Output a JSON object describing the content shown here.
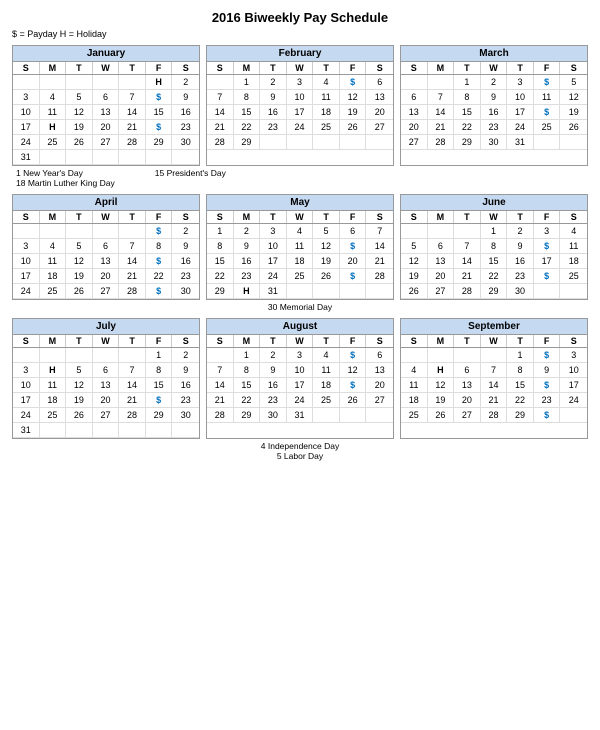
{
  "title": "2016 Biweekly Pay Schedule",
  "legend": "$ = Payday    H = Holiday",
  "months": [
    {
      "name": "January",
      "days": [
        "",
        "",
        "",
        "",
        "",
        "H",
        "2",
        "3",
        "4",
        "5",
        "6",
        "7",
        "$",
        "9",
        "10",
        "11",
        "12",
        "13",
        "14",
        "15",
        "16",
        "17",
        "H",
        "19",
        "20",
        "21",
        "$",
        "23",
        "24",
        "25",
        "26",
        "27",
        "28",
        "29",
        "30",
        "31",
        "",
        "",
        "",
        "",
        "",
        ""
      ],
      "notes": [
        "1 New Year's Day",
        "18 Martin Luther King Day"
      ]
    },
    {
      "name": "February",
      "days": [
        "",
        "1",
        "2",
        "3",
        "4",
        "$",
        "6",
        "7",
        "8",
        "9",
        "10",
        "11",
        "12",
        "13",
        "14",
        "15",
        "16",
        "17",
        "18",
        "19",
        "20",
        "21",
        "22",
        "23",
        "24",
        "25",
        "26",
        "27",
        "28",
        "29",
        "",
        "",
        "",
        "",
        ""
      ],
      "notes": [
        "15 President's Day"
      ]
    },
    {
      "name": "March",
      "days": [
        "",
        "",
        "1",
        "2",
        "3",
        "$",
        "5",
        "6",
        "7",
        "8",
        "9",
        "10",
        "11",
        "12",
        "13",
        "14",
        "15",
        "16",
        "17",
        "$",
        "19",
        "20",
        "21",
        "22",
        "23",
        "24",
        "25",
        "26",
        "27",
        "28",
        "29",
        "30",
        "31",
        "",
        ""
      ],
      "notes": []
    },
    {
      "name": "April",
      "days": [
        "",
        "",
        "",
        "",
        "",
        "$",
        "2",
        "3",
        "4",
        "5",
        "6",
        "7",
        "8",
        "9",
        "10",
        "11",
        "12",
        "13",
        "14",
        "$",
        "16",
        "17",
        "18",
        "19",
        "20",
        "21",
        "22",
        "23",
        "24",
        "25",
        "26",
        "27",
        "28",
        "$",
        "30"
      ],
      "notes": []
    },
    {
      "name": "May",
      "days": [
        "1",
        "2",
        "3",
        "4",
        "5",
        "6",
        "7",
        "8",
        "9",
        "10",
        "11",
        "12",
        "$",
        "14",
        "15",
        "16",
        "17",
        "18",
        "19",
        "20",
        "21",
        "22",
        "23",
        "24",
        "25",
        "26",
        "$",
        "28",
        "29",
        "H",
        "31",
        "",
        "",
        "",
        ""
      ],
      "notes": [
        "30 Memorial Day"
      ]
    },
    {
      "name": "June",
      "days": [
        "",
        "",
        "",
        "1",
        "2",
        "3",
        "4",
        "5",
        "6",
        "7",
        "8",
        "9",
        "$",
        "11",
        "12",
        "13",
        "14",
        "15",
        "16",
        "17",
        "18",
        "19",
        "20",
        "21",
        "22",
        "23",
        "$",
        "25",
        "26",
        "27",
        "28",
        "29",
        "30",
        "",
        ""
      ],
      "notes": []
    },
    {
      "name": "July",
      "days": [
        "",
        "",
        "",
        "",
        "",
        "1",
        "2",
        "3",
        "H",
        "5",
        "6",
        "7",
        "8",
        "9",
        "10",
        "11",
        "12",
        "13",
        "14",
        "15",
        "16",
        "17",
        "18",
        "19",
        "20",
        "21",
        "$",
        "23",
        "24",
        "25",
        "26",
        "27",
        "28",
        "29",
        "30",
        "31",
        "",
        "",
        "",
        "",
        "",
        ""
      ],
      "notes": [
        "4 Independence Day"
      ]
    },
    {
      "name": "August",
      "days": [
        "",
        "1",
        "2",
        "3",
        "4",
        "$",
        "6",
        "7",
        "8",
        "9",
        "10",
        "11",
        "12",
        "13",
        "14",
        "15",
        "16",
        "17",
        "18",
        "$",
        "20",
        "21",
        "22",
        "23",
        "24",
        "25",
        "26",
        "27",
        "28",
        "29",
        "30",
        "31",
        "",
        "",
        ""
      ],
      "notes": []
    },
    {
      "name": "September",
      "days": [
        "",
        "",
        "",
        "",
        "1",
        "$",
        "3",
        "4",
        "H",
        "6",
        "7",
        "8",
        "9",
        "10",
        "11",
        "12",
        "13",
        "14",
        "15",
        "$",
        "17",
        "18",
        "19",
        "20",
        "21",
        "22",
        "23",
        "24",
        "25",
        "26",
        "27",
        "28",
        "29",
        "$",
        ""
      ],
      "notes": [
        "5 Labor Day"
      ]
    }
  ]
}
